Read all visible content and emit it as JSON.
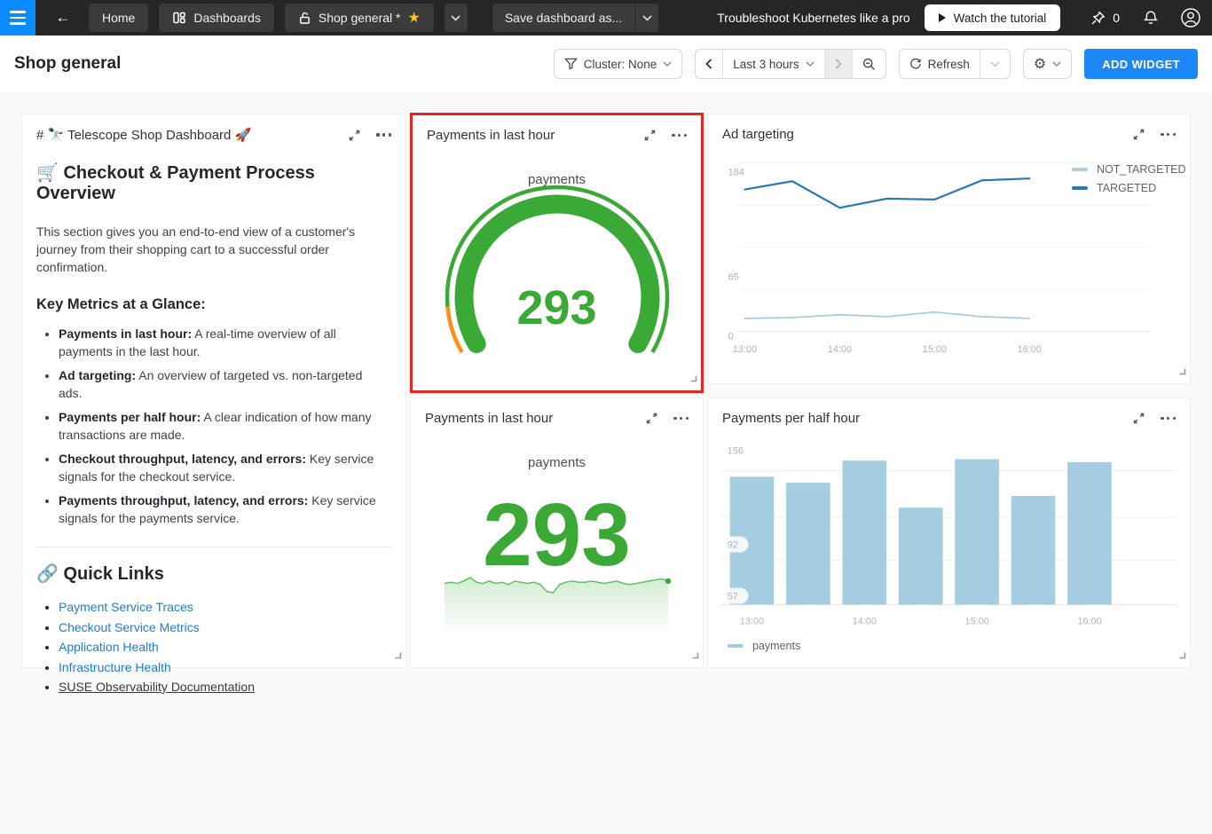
{
  "colors": {
    "accent_blue": "#1b87f8",
    "topbar_blue": "#0d8aff",
    "green": "#3aa935",
    "orange": "#ff9015",
    "bar_blue": "#a5cde2",
    "line_dark_blue": "#2878b4",
    "line_light_blue": "#a9cce0",
    "highlight_red": "#e8251f",
    "star_yellow": "#f6c02d"
  },
  "topbar": {
    "back_icon": "←",
    "star_icon": "★",
    "tabs": [
      {
        "label": "Home"
      },
      {
        "label": "Dashboards"
      },
      {
        "label": "Shop general *"
      }
    ],
    "save_button": "Save dashboard as...",
    "promo_text": "Troubleshoot Kubernetes like a pro",
    "tutorial_button": "Watch the tutorial",
    "pin_count": "0"
  },
  "header": {
    "title": "Shop general",
    "cluster_filter": "Cluster: None",
    "time_range": "Last 3 hours",
    "refresh_label": "Refresh",
    "add_widget_label": "ADD WIDGET"
  },
  "markdown": {
    "title": "# 🔭 Telescope Shop Dashboard 🚀",
    "heading": "🛒 Checkout & Payment Process Overview",
    "intro": "This section gives you an end-to-end view of a customer's journey from their shopping cart to a successful order confirmation.",
    "metrics_heading": "Key Metrics at a Glance:",
    "bullets": [
      {
        "bold": "Payments in last hour:",
        "text": " A real-time overview of all payments in the last hour."
      },
      {
        "bold": "Ad targeting:",
        "text": " An overview of targeted vs. non-targeted ads."
      },
      {
        "bold": "Payments per half hour:",
        "text": " A clear indication of how many transactions are made."
      },
      {
        "bold": "Checkout throughput, latency, and errors:",
        "text": " Key service signals for the checkout service."
      },
      {
        "bold": "Payments throughput, latency, and errors:",
        "text": " Key service signals for the payments service."
      }
    ],
    "quick_links_heading": "🔗 Quick Links",
    "links": [
      {
        "label": "Payment Service Traces"
      },
      {
        "label": "Checkout Service Metrics"
      },
      {
        "label": "Application Health"
      },
      {
        "label": "Infrastructure Health"
      }
    ],
    "doc_link": "SUSE Observability Documentation"
  },
  "chart_data": [
    {
      "id": "payments-gauge",
      "type": "gauge",
      "title": "Payments in last hour",
      "metric_label": "payments",
      "value": "293",
      "gauge_zones": [
        {
          "color": "#ff9015",
          "name": "low-zone"
        },
        {
          "color": "#3aa935",
          "name": "ok-zone"
        }
      ]
    },
    {
      "id": "ad-targeting",
      "type": "line",
      "title": "Ad targeting",
      "x": [
        "13:00",
        "13:30",
        "14:00",
        "14:30",
        "15:00",
        "15:30",
        "16:00"
      ],
      "series": [
        {
          "name": "NOT_TARGETED",
          "color": "#a9cce0",
          "values": [
            14,
            15,
            18,
            16,
            21,
            16,
            14
          ]
        },
        {
          "name": "TARGETED",
          "color": "#2878b4",
          "values": [
            155,
            164,
            135,
            145,
            144,
            165,
            167
          ]
        }
      ],
      "ylim": [
        0,
        184
      ],
      "yticks": [
        184,
        65,
        0
      ],
      "xticks": [
        "13:00",
        "14:00",
        "15:00",
        "16:00"
      ],
      "legend_position": "right",
      "grid": true
    },
    {
      "id": "payments-number",
      "type": "number+sparkline",
      "title": "Payments in last hour",
      "metric_label": "payments",
      "value": "293",
      "sparkline": [
        291,
        292,
        291,
        293,
        296,
        292,
        291,
        293,
        291,
        292,
        290,
        293,
        292,
        291,
        292,
        290,
        284,
        283,
        290,
        292,
        293,
        292,
        292,
        293,
        292,
        291,
        292,
        293,
        291,
        290,
        291,
        292,
        293,
        294,
        295,
        293
      ]
    },
    {
      "id": "payments-per-half-hour",
      "type": "bar",
      "title": "Payments per half hour",
      "categories": [
        "13:00",
        "13:30",
        "14:00",
        "14:30",
        "15:00",
        "15:30",
        "16:00"
      ],
      "values": [
        138,
        134,
        149,
        117,
        150,
        125,
        148
      ],
      "ylim": [
        51,
        164
      ],
      "yticks": [
        156,
        92,
        57
      ],
      "xticks": [
        "13:00",
        "14:00",
        "15:00",
        "16:00"
      ],
      "legend": "payments",
      "grid": true
    }
  ]
}
